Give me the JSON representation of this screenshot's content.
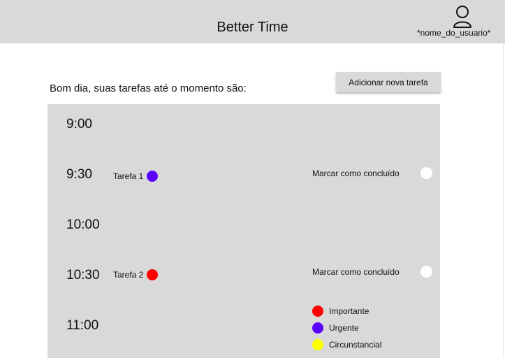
{
  "header": {
    "app_title": "Better Time",
    "username": "*nome_do_usuario*"
  },
  "main": {
    "greeting": "Bom dia, suas tarefas até o momento são:",
    "add_task_label": "Adicionar nova tarefa"
  },
  "schedule": {
    "slots": [
      {
        "time": "9:00"
      },
      {
        "time": "9:30",
        "task": "Tarefa 1",
        "task_color": "#5a00ff",
        "mark_label": "Marcar como concluído"
      },
      {
        "time": "10:00"
      },
      {
        "time": "10:30",
        "task": "Tarefa 2",
        "task_color": "#ff0000",
        "mark_label": "Marcar como concluído"
      },
      {
        "time": "11:00"
      }
    ]
  },
  "legend": [
    {
      "label": "Importante",
      "color": "#ff0000"
    },
    {
      "label": "Urgente",
      "color": "#5a00ff"
    },
    {
      "label": "Circunstancial",
      "color": "#ffff00"
    }
  ],
  "colors": {
    "header_bg": "#d9d9d9",
    "panel_bg": "#d9d9d9"
  }
}
